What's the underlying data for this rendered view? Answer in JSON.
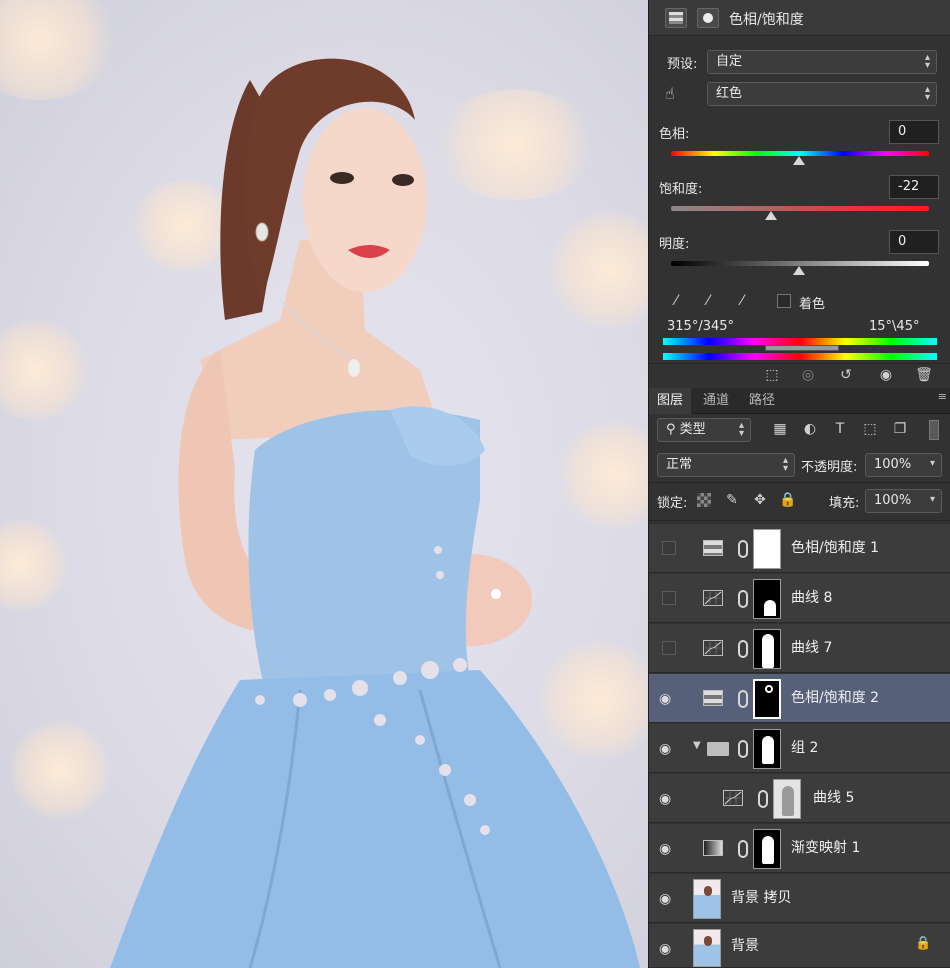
{
  "properties": {
    "title": "色相/饱和度",
    "preset_label": "预设:",
    "preset_value": "自定",
    "channel_value": "红色",
    "hue_label": "色相:",
    "hue_value": "0",
    "saturation_label": "饱和度:",
    "saturation_value": "-22",
    "lightness_label": "明度:",
    "lightness_value": "0",
    "colorize_label": "着色",
    "range_left": "315°/345°",
    "range_right": "15°\\45°"
  },
  "layers_panel": {
    "tabs": [
      "图层",
      "通道",
      "路径"
    ],
    "filter_value": "类型",
    "blend_mode": "正常",
    "opacity_label": "不透明度:",
    "opacity_value": "100%",
    "lock_label": "锁定:",
    "fill_label": "填充:",
    "fill_value": "100%",
    "layers": [
      {
        "name": "色相/饱和度 1",
        "visible": false,
        "type": "hue-saturation"
      },
      {
        "name": "曲线 8",
        "visible": false,
        "type": "curves"
      },
      {
        "name": "曲线 7",
        "visible": false,
        "type": "curves"
      },
      {
        "name": "色相/饱和度 2",
        "visible": true,
        "type": "hue-saturation",
        "selected": true
      },
      {
        "name": "组 2",
        "visible": true,
        "type": "group"
      },
      {
        "name": "曲线 5",
        "visible": true,
        "type": "curves"
      },
      {
        "name": "渐变映射 1",
        "visible": true,
        "type": "gradient-map"
      },
      {
        "name": "背景 拷贝",
        "visible": true,
        "type": "image"
      },
      {
        "name": "背景",
        "visible": true,
        "type": "image",
        "locked": true
      }
    ]
  },
  "colors": {
    "panel_bg": "#323232",
    "selected_row": "#566079",
    "dress": "#9cc2e8"
  }
}
